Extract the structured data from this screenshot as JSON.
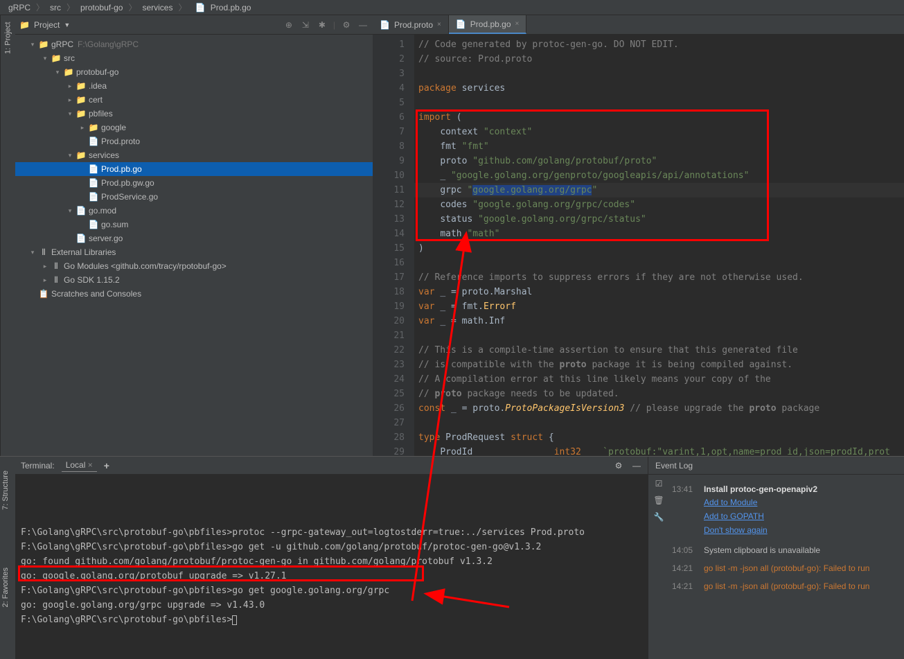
{
  "breadcrumb": [
    "gRPC",
    "src",
    "protobuf-go",
    "services",
    "Prod.pb.go"
  ],
  "project_panel": {
    "title": "Project",
    "tree": [
      {
        "depth": 0,
        "arrow": "v",
        "icon": "folder",
        "label": "gRPC",
        "hint": "F:\\Golang\\gRPC"
      },
      {
        "depth": 1,
        "arrow": "v",
        "icon": "folder",
        "label": "src"
      },
      {
        "depth": 2,
        "arrow": "v",
        "icon": "folder",
        "label": "protobuf-go"
      },
      {
        "depth": 3,
        "arrow": ">",
        "icon": "folder",
        "label": ".idea"
      },
      {
        "depth": 3,
        "arrow": ">",
        "icon": "folder",
        "label": "cert"
      },
      {
        "depth": 3,
        "arrow": "v",
        "icon": "folder",
        "label": "pbfiles"
      },
      {
        "depth": 4,
        "arrow": ">",
        "icon": "folder",
        "label": "google"
      },
      {
        "depth": 4,
        "arrow": "",
        "icon": "proto",
        "label": "Prod.proto"
      },
      {
        "depth": 3,
        "arrow": "v",
        "icon": "folder",
        "label": "services"
      },
      {
        "depth": 4,
        "arrow": "",
        "icon": "go",
        "label": "Prod.pb.go",
        "selected": true
      },
      {
        "depth": 4,
        "arrow": "",
        "icon": "go",
        "label": "Prod.pb.gw.go"
      },
      {
        "depth": 4,
        "arrow": "",
        "icon": "go",
        "label": "ProdService.go"
      },
      {
        "depth": 3,
        "arrow": "v",
        "icon": "mod",
        "label": "go.mod"
      },
      {
        "depth": 4,
        "arrow": "",
        "icon": "sum",
        "label": "go.sum"
      },
      {
        "depth": 3,
        "arrow": "",
        "icon": "go",
        "label": "server.go"
      },
      {
        "depth": 0,
        "arrow": "v",
        "icon": "lib",
        "label": "External Libraries"
      },
      {
        "depth": 1,
        "arrow": ">",
        "icon": "lib",
        "label": "Go Modules <github.com/tracy/rpotobuf-go>"
      },
      {
        "depth": 1,
        "arrow": ">",
        "icon": "lib",
        "label": "Go SDK 1.15.2"
      },
      {
        "depth": 0,
        "arrow": "",
        "icon": "scratch",
        "label": "Scratches and Consoles"
      }
    ]
  },
  "side_tab": "1: Project",
  "tabs": [
    {
      "icon": "proto",
      "label": "Prod.proto",
      "active": false
    },
    {
      "icon": "go",
      "label": "Prod.pb.go",
      "active": true
    }
  ],
  "code": {
    "lines": [
      {
        "n": 1,
        "html": "<span class='cmt'>// Code generated by protoc-gen-go. DO NOT EDIT.</span>"
      },
      {
        "n": 2,
        "html": "<span class='cmt'>// source: Prod.proto</span>"
      },
      {
        "n": 3,
        "html": ""
      },
      {
        "n": 4,
        "html": "<span class='kw'>package</span> <span class='id'>services</span>"
      },
      {
        "n": 5,
        "html": ""
      },
      {
        "n": 6,
        "html": "<span class='kw'>import</span> <span class='id'>(</span>"
      },
      {
        "n": 7,
        "html": "    <span class='id'>context</span> <span class='str'>\"context\"</span>"
      },
      {
        "n": 8,
        "html": "    <span class='id'>fmt</span> <span class='str'>\"fmt\"</span>"
      },
      {
        "n": 9,
        "html": "    <span class='id'>proto</span> <span class='str'>\"github.com/golang/protobuf/proto\"</span>"
      },
      {
        "n": 10,
        "html": "    <span class='id'>_</span> <span class='str'>\"google.golang.org/genproto/googleapis/api/annotations\"</span>"
      },
      {
        "n": 11,
        "html": "    <span class='id'>grpc</span> <span class='str'>\"<span class='sel-text'>google.golang.org/grpc</span>\"</span>",
        "current": true
      },
      {
        "n": 12,
        "html": "    <span class='id'>codes</span> <span class='str'>\"google.golang.org/grpc/codes\"</span>"
      },
      {
        "n": 13,
        "html": "    <span class='id'>status</span> <span class='str'>\"google.golang.org/grpc/status\"</span>"
      },
      {
        "n": 14,
        "html": "    <span class='id'>math</span> <span class='str'>\"math\"</span>"
      },
      {
        "n": 15,
        "html": "<span class='id'>)</span>"
      },
      {
        "n": 16,
        "html": ""
      },
      {
        "n": 17,
        "html": "<span class='cmt'>// Reference imports to suppress errors if they are not otherwise used.</span>"
      },
      {
        "n": 18,
        "html": "<span class='kw'>var</span> <span class='id'>_ = proto.Marshal</span>"
      },
      {
        "n": 19,
        "html": "<span class='kw'>var</span> <span class='id'>_ = fmt.</span><span class='fn'>Errorf</span>"
      },
      {
        "n": 20,
        "html": "<span class='kw'>var</span> <span class='id'>_ = math.Inf</span>"
      },
      {
        "n": 21,
        "html": ""
      },
      {
        "n": 22,
        "html": "<span class='cmt'>// This is a compile-time assertion to ensure that this generated file</span>"
      },
      {
        "n": 23,
        "html": "<span class='cmt'>// is compatible with the </span><span class='cmt'><b>proto</b></span><span class='cmt'> package it is being compiled against.</span>"
      },
      {
        "n": 24,
        "html": "<span class='cmt'>// A compilation error at this line likely means your copy of the</span>"
      },
      {
        "n": 25,
        "html": "<span class='cmt'>// </span><span class='cmt'><b>proto</b></span><span class='cmt'> package needs to be updated.</span>"
      },
      {
        "n": 26,
        "html": "<span class='kw'>const</span> <span class='id'>_ = proto.</span><span class='fn strf'>ProtoPackageIsVersion3</span> <span class='cmt'>// please upgrade the <b>proto</b> package</span>"
      },
      {
        "n": 27,
        "html": ""
      },
      {
        "n": 28,
        "html": "<span class='kw'>type</span> <span class='id'>ProdRequest</span> <span class='kw'>struct</span> <span class='id'>{</span>"
      },
      {
        "n": 29,
        "html": "    <span class='id'>ProdId</span>               <span class='kw'>int32</span>    <span class='str'>`protobuf:\"varint,1,opt,name=prod_id,json=prodId,prot</span>"
      }
    ]
  },
  "terminal": {
    "title": "Terminal:",
    "tab": "Local",
    "lines": [
      "F:\\Golang\\gRPC\\src\\protobuf-go\\pbfiles>protoc --grpc-gateway_out=logtostderr=true:../services Prod.proto",
      "",
      "F:\\Golang\\gRPC\\src\\protobuf-go\\pbfiles>go get -u github.com/golang/protobuf/protoc-gen-go@v1.3.2",
      "go: found github.com/golang/protobuf/protoc-gen-go in github.com/golang/protobuf v1.3.2",
      "go: google.golang.org/protobuf upgrade => v1.27.1",
      "",
      "F:\\Golang\\gRPC\\src\\protobuf-go\\pbfiles>go get google.golang.org/grpc",
      "go: google.golang.org/grpc upgrade => v1.43.0",
      "",
      "F:\\Golang\\gRPC\\src\\protobuf-go\\pbfiles>"
    ]
  },
  "event_log": {
    "title": "Event Log",
    "events": [
      {
        "time": "13:41",
        "title": "Install protoc-gen-openapiv2",
        "links": [
          "Add to Module",
          "Add to GOPATH",
          "Don't show again"
        ]
      },
      {
        "time": "14:05",
        "text": "System clipboard is unavailable"
      },
      {
        "time": "14:21",
        "err": "go list -m -json all (protobuf-go): Failed to run"
      },
      {
        "time": "14:21",
        "err": "go list -m -json all (protobuf-go): Failed to run"
      }
    ]
  },
  "side_tabs_bottom": [
    "7: Structure",
    "2: Favorites"
  ]
}
